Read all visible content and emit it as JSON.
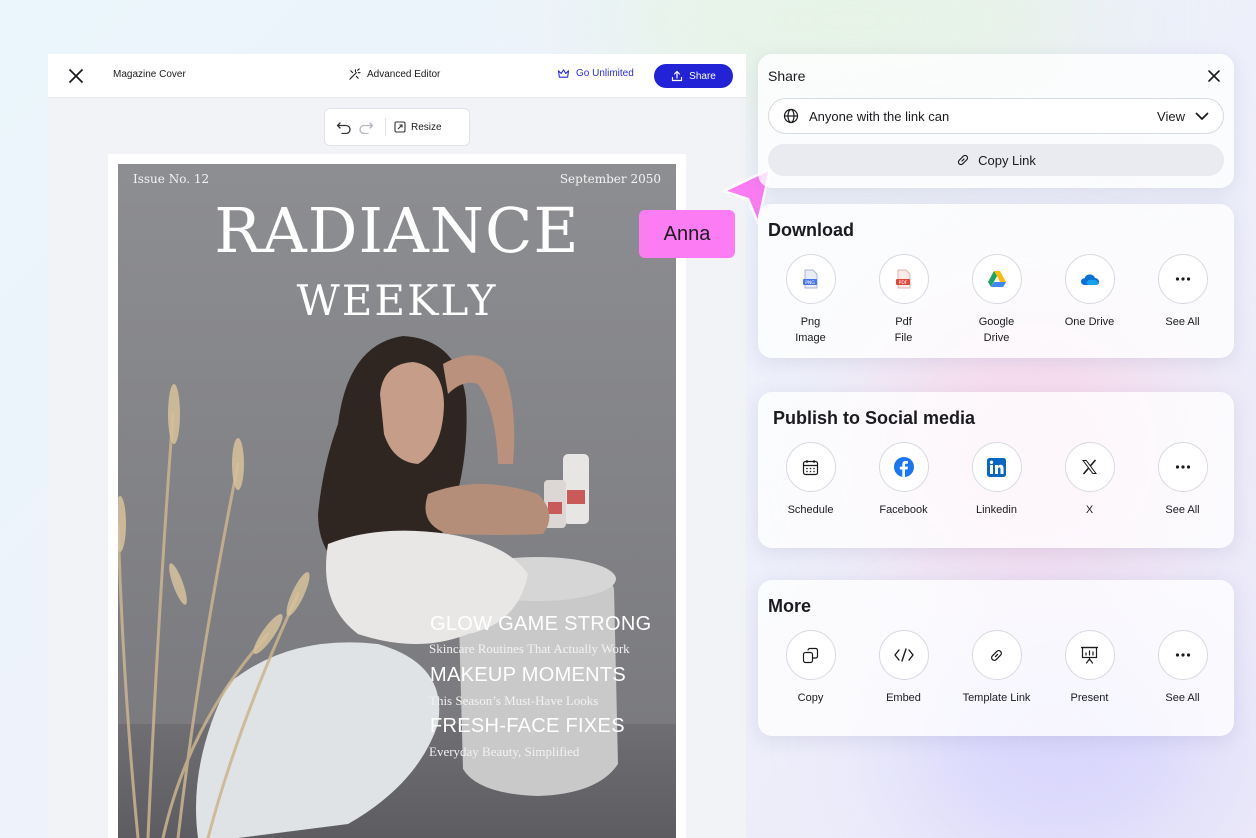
{
  "editor": {
    "doc_title": "Magazine Cover",
    "advanced_editor": "Advanced Editor",
    "go_unlimited": "Go Unlimited",
    "share": "Share",
    "resize": "Resize"
  },
  "cover": {
    "issue": "Issue No. 12",
    "date": "September 2050",
    "masthead_1": "RADIANCE",
    "masthead_2": "WEEKLY",
    "headlines": [
      {
        "title": "GLOW GAME STRONG",
        "subtitle": "Skincare Routines That Actually Work"
      },
      {
        "title": "MAKEUP MOMENTS",
        "subtitle": "This Season’s Must-Have Looks"
      },
      {
        "title": "FRESH-FACE FIXES",
        "subtitle": "Everyday Beauty, Simplified"
      }
    ]
  },
  "collaborator": {
    "name": "Anna",
    "color": "#fb7cf3"
  },
  "share_panel": {
    "title": "Share",
    "permission_label": "Anyone with the link can",
    "permission_value": "View",
    "copy_link": "Copy Link"
  },
  "download": {
    "title": "Download",
    "items": [
      {
        "icon": "png-file-icon",
        "label": "Png\nImage"
      },
      {
        "icon": "pdf-file-icon",
        "label": "Pdf\nFile"
      },
      {
        "icon": "google-drive-icon",
        "label": "Google\nDrive"
      },
      {
        "icon": "onedrive-icon",
        "label": "One Drive"
      },
      {
        "icon": "more-icon",
        "label": "See All"
      }
    ]
  },
  "social": {
    "title": "Publish to Social media",
    "items": [
      {
        "icon": "calendar-icon",
        "label": "Schedule"
      },
      {
        "icon": "facebook-icon",
        "label": "Facebook"
      },
      {
        "icon": "linkedin-icon",
        "label": "Linkedin"
      },
      {
        "icon": "x-icon",
        "label": "X"
      },
      {
        "icon": "more-icon",
        "label": "See All"
      }
    ]
  },
  "more": {
    "title": "More",
    "items": [
      {
        "icon": "copy-icon",
        "label": "Copy"
      },
      {
        "icon": "code-icon",
        "label": "Embed"
      },
      {
        "icon": "link-icon",
        "label": "Template Link"
      },
      {
        "icon": "present-icon",
        "label": "Present"
      },
      {
        "icon": "more-icon",
        "label": "See All"
      }
    ]
  },
  "colors": {
    "accent": "#2223d6",
    "cursor": "#fb7cf3"
  }
}
